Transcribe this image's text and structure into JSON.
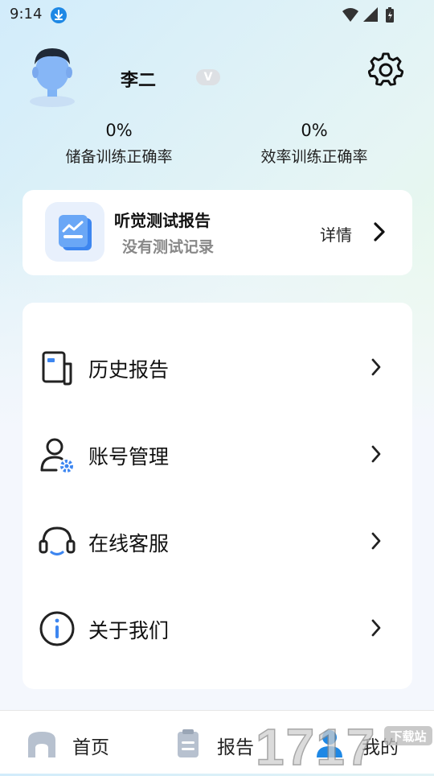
{
  "status_bar": {
    "time": "9:14"
  },
  "profile": {
    "name": "李二",
    "badge": "V",
    "stats": [
      {
        "value": "0%",
        "label": "储备训练正确率"
      },
      {
        "value": "0%",
        "label": "效率训练正确率"
      }
    ]
  },
  "report_card": {
    "title": "听觉测试报告",
    "subtitle": "没有测试记录",
    "detail_label": "详情"
  },
  "menu": {
    "items": [
      {
        "label": "历史报告",
        "icon": "document-icon"
      },
      {
        "label": "账号管理",
        "icon": "user-settings-icon"
      },
      {
        "label": "在线客服",
        "icon": "headset-icon"
      },
      {
        "label": "关于我们",
        "icon": "info-icon"
      }
    ]
  },
  "bottom_nav": {
    "items": [
      {
        "label": "首页",
        "icon": "home-icon"
      },
      {
        "label": "报告",
        "icon": "clipboard-icon"
      },
      {
        "label": "我的",
        "icon": "profile-icon",
        "active": true
      }
    ]
  },
  "watermark": {
    "text": "1717",
    "badge": "下载站"
  },
  "colors": {
    "accent": "#1e88e5",
    "muted": "#888888",
    "card": "#ffffff"
  }
}
